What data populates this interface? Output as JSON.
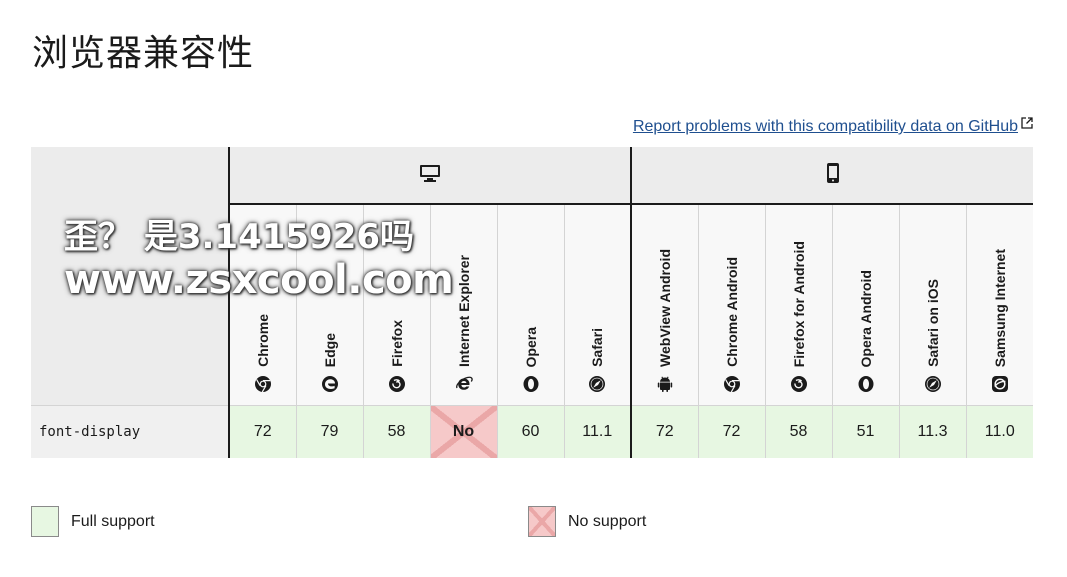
{
  "page": {
    "title": "浏览器兼容性",
    "report_link": "Report problems with this compatibility data on GitHub"
  },
  "platforms": {
    "desktop_icon": "desktop-icon",
    "mobile_icon": "mobile-icon"
  },
  "browsers": [
    {
      "name": "Chrome",
      "icon": "chrome-icon"
    },
    {
      "name": "Edge",
      "icon": "edge-icon"
    },
    {
      "name": "Firefox",
      "icon": "firefox-icon"
    },
    {
      "name": "Internet Explorer",
      "icon": "ie-icon"
    },
    {
      "name": "Opera",
      "icon": "opera-icon"
    },
    {
      "name": "Safari",
      "icon": "safari-icon"
    },
    {
      "name": "WebView Android",
      "icon": "android-icon"
    },
    {
      "name": "Chrome Android",
      "icon": "chrome-icon"
    },
    {
      "name": "Firefox for Android",
      "icon": "firefox-icon"
    },
    {
      "name": "Opera Android",
      "icon": "opera-icon"
    },
    {
      "name": "Safari on iOS",
      "icon": "safari-icon"
    },
    {
      "name": "Samsung Internet",
      "icon": "samsung-icon"
    }
  ],
  "feature": {
    "name": "font-display",
    "support": [
      {
        "value": "72",
        "status": "full"
      },
      {
        "value": "79",
        "status": "full"
      },
      {
        "value": "58",
        "status": "full"
      },
      {
        "value": "No",
        "status": "no"
      },
      {
        "value": "60",
        "status": "full"
      },
      {
        "value": "11.1",
        "status": "full"
      },
      {
        "value": "72",
        "status": "full"
      },
      {
        "value": "72",
        "status": "full"
      },
      {
        "value": "58",
        "status": "full"
      },
      {
        "value": "51",
        "status": "full"
      },
      {
        "value": "11.3",
        "status": "full"
      },
      {
        "value": "11.0",
        "status": "full"
      }
    ]
  },
  "legend": {
    "full": "Full support",
    "no": "No support"
  },
  "colors": {
    "full_support": "#e7f7e2",
    "no_support": "#f6c9c9",
    "link": "#1f4f8f"
  },
  "watermark": {
    "line1": "歪？ 是3.1415926吗",
    "line2": "www.zsxcool.com"
  }
}
